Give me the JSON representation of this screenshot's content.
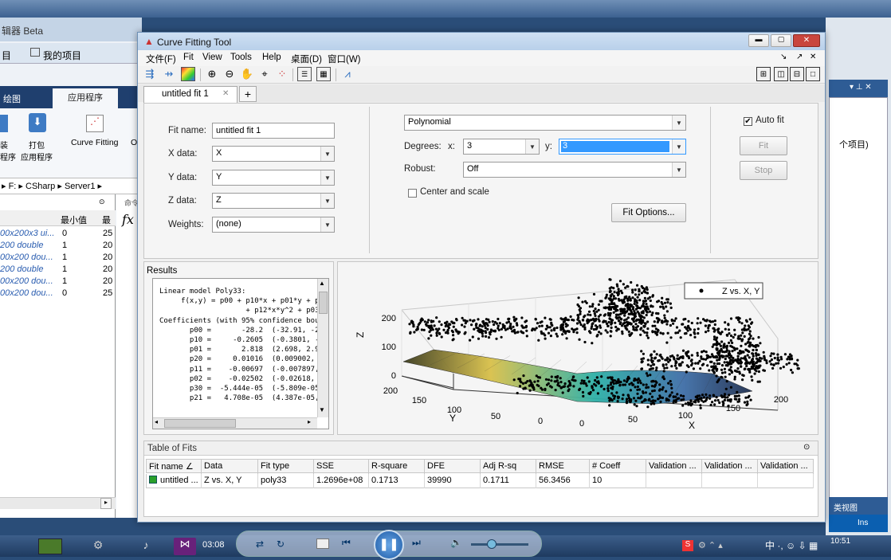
{
  "background_window": {
    "title": "辑器 Beta",
    "project_items": [
      "目",
      "我的项目"
    ],
    "ribbon_tabs": [
      "绘图",
      "应用程序"
    ],
    "ribbon_buttons": [
      "装\n程序",
      "打包\n应用程序",
      "Curve Fitting",
      "O"
    ],
    "breadcrumb": [
      "F:",
      "CSharp",
      "Server1"
    ],
    "workspace_headers": [
      "",
      "最小值",
      "最"
    ],
    "workspace_rows": [
      {
        "value": "00x200x3 ui...",
        "min": "0",
        "max": "25"
      },
      {
        "value": "200 double",
        "min": "1",
        "max": "20"
      },
      {
        "value": "00x200 dou...",
        "min": "1",
        "max": "20"
      },
      {
        "value": "200 double",
        "min": "1",
        "max": "20"
      },
      {
        "value": "00x200 dou...",
        "min": "1",
        "max": "20"
      },
      {
        "value": "00x200 dou...",
        "min": "0",
        "max": "25"
      }
    ],
    "cmd_label": "命令",
    "fx": "fx"
  },
  "right_panel": {
    "text1": "个项目)",
    "bottom_label": "类视图",
    "status": "Ins"
  },
  "window": {
    "title": "Curve Fitting Tool",
    "menu": [
      "文件(F)",
      "Fit",
      "View",
      "Tools",
      "Help",
      "桌面(D)",
      "窗口(W)"
    ],
    "menu_right": [
      "↘",
      "↗",
      "✕"
    ]
  },
  "tabs": [
    {
      "label": "untitled fit 1"
    }
  ],
  "add_tab": "+",
  "fit_form": {
    "fit_name_label": "Fit name:",
    "fit_name_value": "untitled fit 1",
    "x_label": "X data:",
    "x_value": "X",
    "y_label": "Y data:",
    "y_value": "Y",
    "z_label": "Z data:",
    "z_value": "Z",
    "weights_label": "Weights:",
    "weights_value": "(none)"
  },
  "fit_options": {
    "model_type": "Polynomial",
    "degrees_label": "Degrees:",
    "x_deg_label": "x:",
    "x_deg_value": "3",
    "y_deg_label": "y:",
    "y_deg_value": "3",
    "robust_label": "Robust:",
    "robust_value": "Off",
    "center_scale_label": "Center and scale",
    "fit_options_button": "Fit Options...",
    "auto_fit_label": "Auto fit",
    "fit_button": "Fit",
    "stop_button": "Stop"
  },
  "results": {
    "title": "Results",
    "lines": [
      "Linear model Poly33:",
      "     f(x,y) = p00 + p10*x + p01*y + p",
      "                    + p12*x*y^2 + p03",
      "Coefficients (with 95% confidence bou",
      "       p00 =       -28.2  (-32.91, -2",
      "       p10 =     -0.2605  (-0.3801, -",
      "       p01 =       2.818  (2.698, 2.9",
      "       p20 =     0.01016  (0.009002, ",
      "       p11 =    -0.00697  (-0.007897,",
      "       p02 =    -0.02502  (-0.02618, ",
      "       p30 =  -5.444e-05  (-5.809e-05",
      "       p21 =   4.708e-05  (4.387e-05,"
    ]
  },
  "plot": {
    "legend": "Z vs. X, Y",
    "z_axis_label": "Z",
    "x_axis_label": "X",
    "y_axis_label": "Y",
    "z_ticks": [
      "200",
      "100",
      "0"
    ],
    "x_ticks": [
      "0",
      "50",
      "100",
      "150",
      "200"
    ],
    "y_ticks": [
      "200",
      "150",
      "100",
      "50",
      "0"
    ]
  },
  "table_of_fits": {
    "title": "Table of Fits",
    "headers": [
      "Fit name ∠",
      "Data",
      "Fit type",
      "SSE",
      "R-square",
      "DFE",
      "Adj R-sq",
      "RMSE",
      "# Coeff",
      "Validation ...",
      "Validation ...",
      "Validation ..."
    ],
    "row": [
      "untitled ...",
      "Z vs. X, Y",
      "poly33",
      "1.2696e+08",
      "0.1713",
      "39990",
      "0.1711",
      "56.3456",
      "10",
      "",
      "",
      ""
    ]
  },
  "taskbar": {
    "time_elapsed": "03:08",
    "clock": "10:51"
  },
  "colors": {
    "accent": "#3399ff",
    "fit_surface": "#e0c040",
    "titlebar_red": "#c9463d"
  }
}
